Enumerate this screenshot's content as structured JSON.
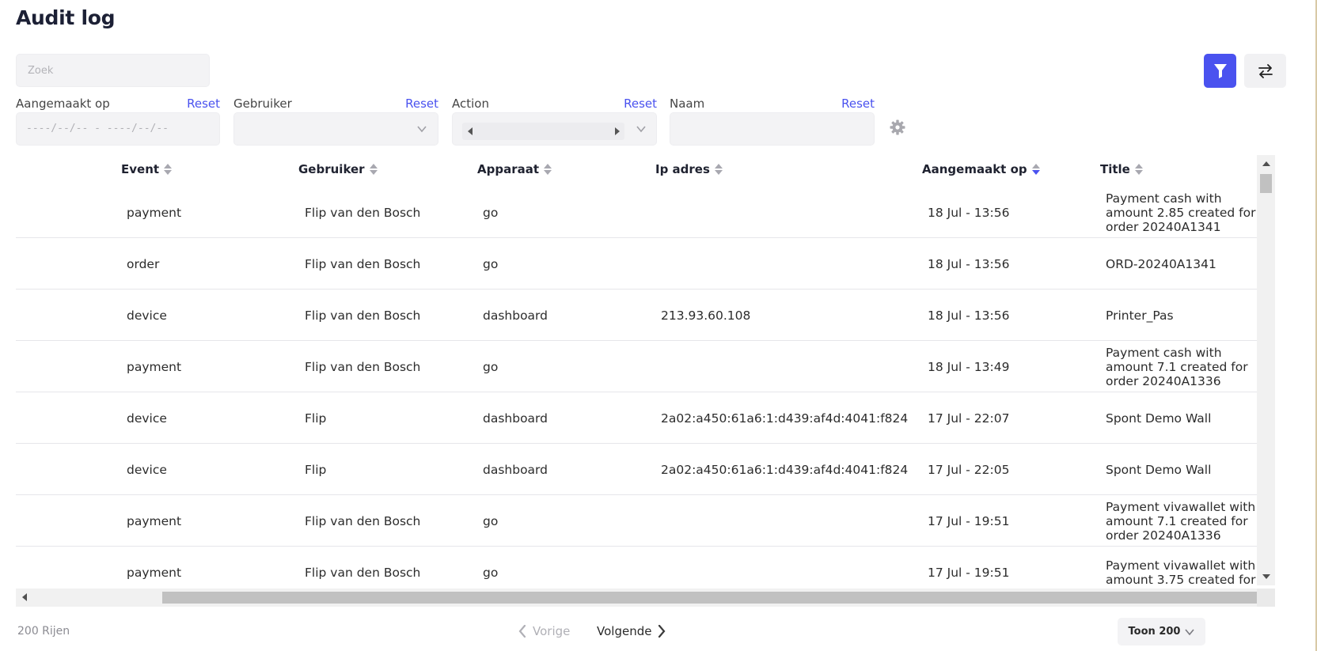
{
  "page": {
    "title": "Audit log"
  },
  "search": {
    "placeholder": "Zoek",
    "value": ""
  },
  "filters": [
    {
      "label": "Aangemaakt op",
      "reset": "Reset",
      "value": "----/--/-- - ----/--/--"
    },
    {
      "label": "Gebruiker",
      "reset": "Reset",
      "value": ""
    },
    {
      "label": "Action",
      "reset": "Reset",
      "value": ""
    },
    {
      "label": "Naam",
      "reset": "Reset",
      "value": ""
    }
  ],
  "columns": [
    {
      "label": "Event",
      "sort": "none"
    },
    {
      "label": "Gebruiker",
      "sort": "none"
    },
    {
      "label": "Apparaat",
      "sort": "none"
    },
    {
      "label": "Ip adres",
      "sort": "none"
    },
    {
      "label": "Aangemaakt op",
      "sort": "desc"
    },
    {
      "label": "Title",
      "sort": "none"
    }
  ],
  "rows": [
    {
      "event": "payment",
      "user": "Flip van den Bosch",
      "device": "go",
      "ip": "",
      "created": "18 Jul - 13:56",
      "title": "Payment cash with amount 2.85 created for order 20240A1341"
    },
    {
      "event": "order",
      "user": "Flip van den Bosch",
      "device": "go",
      "ip": "",
      "created": "18 Jul - 13:56",
      "title": "ORD-20240A1341"
    },
    {
      "event": "device",
      "user": "Flip van den Bosch",
      "device": "dashboard",
      "ip": "213.93.60.108",
      "created": "18 Jul - 13:56",
      "title": "Printer_Pas"
    },
    {
      "event": "payment",
      "user": "Flip van den Bosch",
      "device": "go",
      "ip": "",
      "created": "18 Jul - 13:49",
      "title": "Payment cash with amount 7.1 created for order 20240A1336"
    },
    {
      "event": "device",
      "user": "Flip",
      "device": "dashboard",
      "ip": "2a02:a450:61a6:1:d439:af4d:4041:f824",
      "created": "17 Jul - 22:07",
      "title": "Spont Demo Wall"
    },
    {
      "event": "device",
      "user": "Flip",
      "device": "dashboard",
      "ip": "2a02:a450:61a6:1:d439:af4d:4041:f824",
      "created": "17 Jul - 22:05",
      "title": "Spont Demo Wall"
    },
    {
      "event": "payment",
      "user": "Flip van den Bosch",
      "device": "go",
      "ip": "",
      "created": "17 Jul - 19:51",
      "title": "Payment vivawallet with amount 7.1 created for order 20240A1336"
    },
    {
      "event": "payment",
      "user": "Flip van den Bosch",
      "device": "go",
      "ip": "",
      "created": "17 Jul - 19:51",
      "title": "Payment vivawallet with amount 3.75 created for"
    }
  ],
  "footer": {
    "rows_count": "200 Rijen",
    "prev": "Vorige",
    "next": "Volgende",
    "page_size": "Toon 200"
  },
  "colors": {
    "accent": "#4a52ef",
    "muted": "#b0b0b6"
  },
  "icons": {
    "filter": "funnel-icon",
    "swap": "swap-arrows-icon",
    "settings": "gear-icon"
  }
}
